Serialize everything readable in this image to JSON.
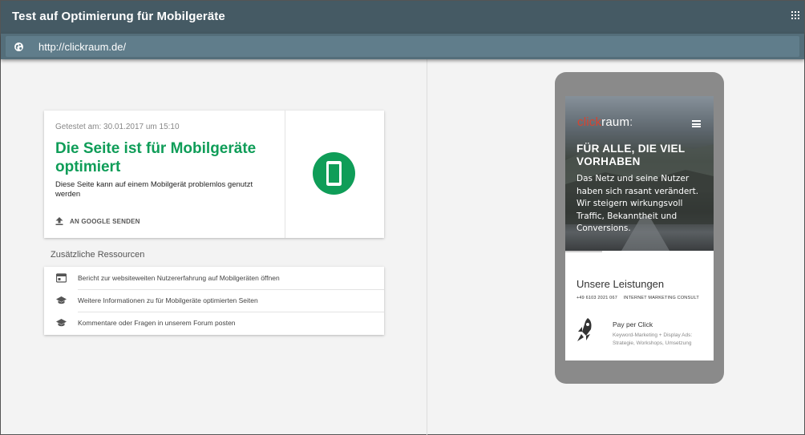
{
  "app": {
    "title": "Test auf Optimierung für Mobilgeräte"
  },
  "urlbar": {
    "url": "http://clickraum.de/"
  },
  "result": {
    "tested": "Getestet am: 30.01.2017 um 15:10",
    "headline": "Die Seite ist für Mobilgeräte optimiert",
    "description": "Diese Seite kann auf einem Mobilgerät problemlos genutzt werden",
    "send_label": "AN GOOGLE SENDEN",
    "accent": "#0f9d58"
  },
  "resources": {
    "title": "Zusätzliche Ressourcen",
    "items": [
      {
        "icon": "report-icon",
        "label": "Bericht zur websiteweiten Nutzererfahrung auf Mobilgeräten öffnen"
      },
      {
        "icon": "graduation-cap-icon",
        "label": "Weitere Informationen zu für Mobilgeräte optimierten Seiten"
      },
      {
        "icon": "graduation-cap-icon",
        "label": "Kommentare oder Fragen in unserem Forum posten"
      }
    ]
  },
  "preview": {
    "logo_click": "click",
    "logo_rest": "raum",
    "logo_colon": ":",
    "headline": "FÜR ALLE, DIE VIEL VORHABEN",
    "text": "Das Netz und seine Nutzer haben sich rasant verändert. Wir steigern wirkungsvoll Traffic, Bekanntheit und Conversions.",
    "section_title": "Unsere Leistungen",
    "phone": "+49 6103 2021 067",
    "tagline": "INTERNET MARKETING CONSULT",
    "service_title": "Pay per Click",
    "service_desc": "Keyword-Marketing + Display Ads: Strategie, Workshops, Umsetzung"
  }
}
